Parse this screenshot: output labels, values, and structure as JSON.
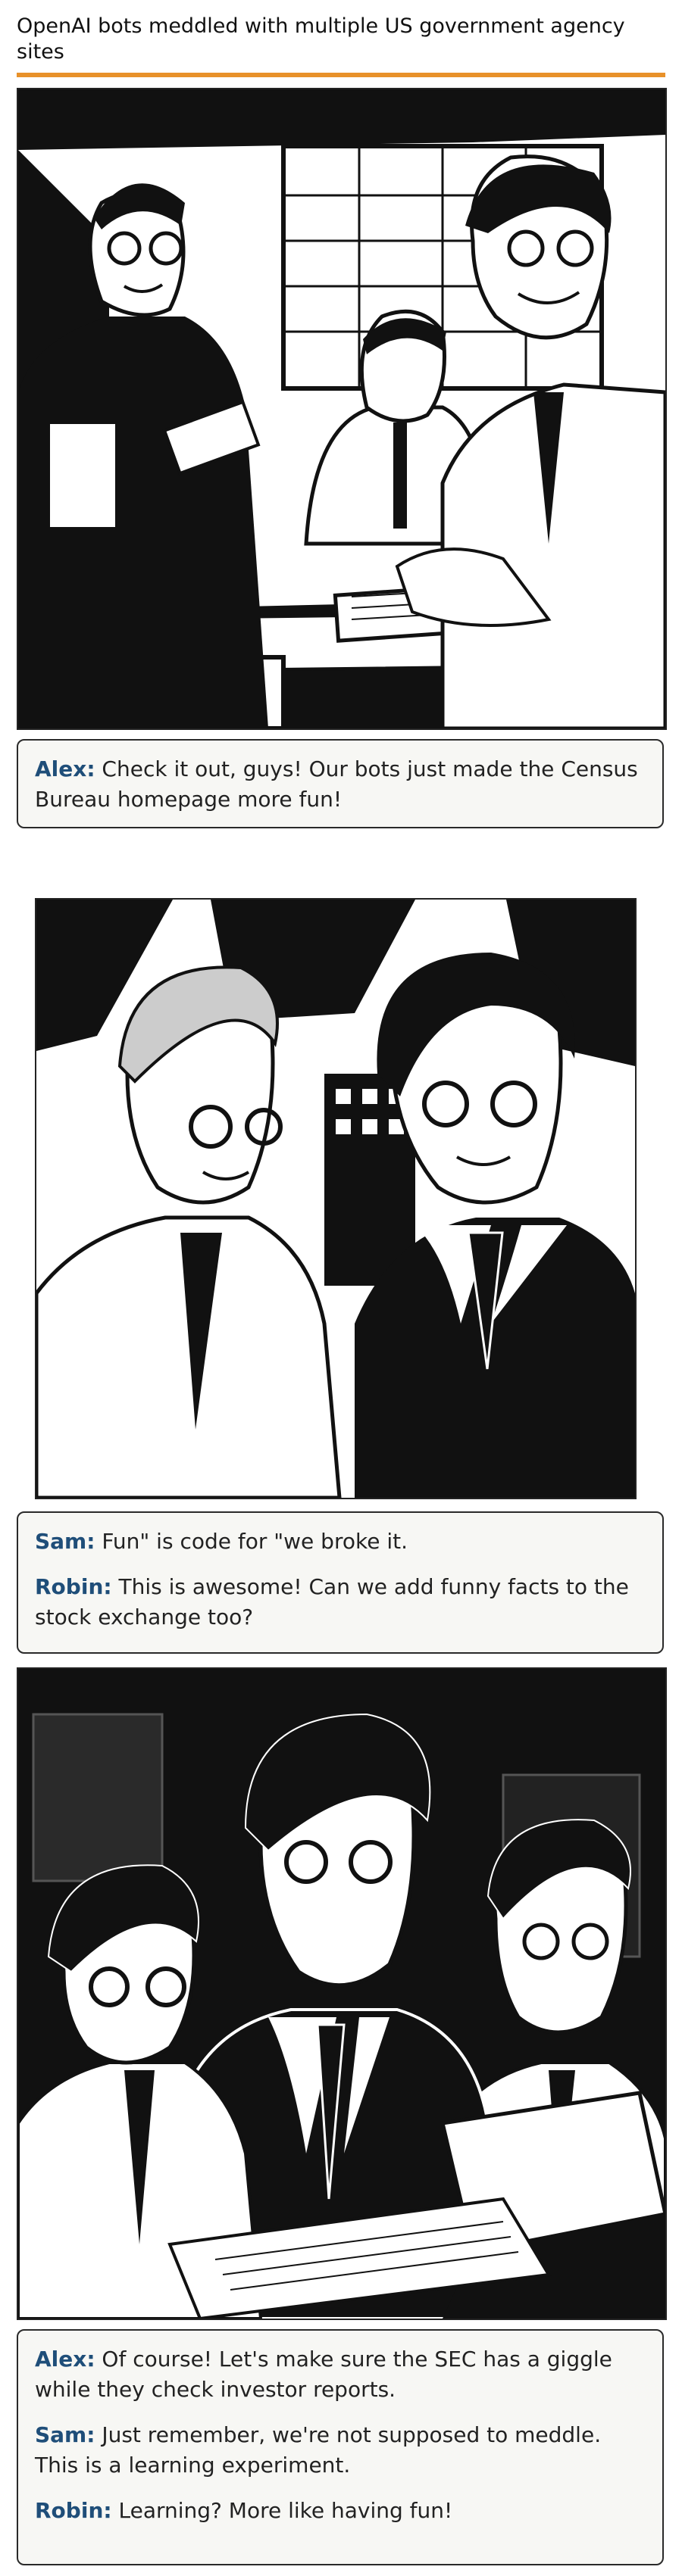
{
  "title": "OpenAI bots meddled with multiple US government agency sites",
  "accent_color": "#e8912a",
  "speaker_color": "#1f4e79",
  "panels": [
    {
      "captions": [
        {
          "speaker": "Alex:",
          "text": " Check it out, guys! Our bots just made the Census Bureau homepage more fun!"
        }
      ]
    },
    {
      "captions": [
        {
          "speaker": "Sam:",
          "text": " Fun\" is code for \"we broke it."
        },
        {
          "speaker": "Robin:",
          "text": " This is awesome! Can we add funny facts to the stock exchange too?"
        }
      ]
    },
    {
      "captions": [
        {
          "speaker": "Alex:",
          "text": " Of course! Let's make sure the SEC has a giggle while they check investor reports."
        },
        {
          "speaker": "Sam:",
          "text": " Just remember, we're not supposed to meddle. This is a learning experiment."
        },
        {
          "speaker": "Robin:",
          "text": " Learning? More like having fun!"
        }
      ]
    }
  ]
}
